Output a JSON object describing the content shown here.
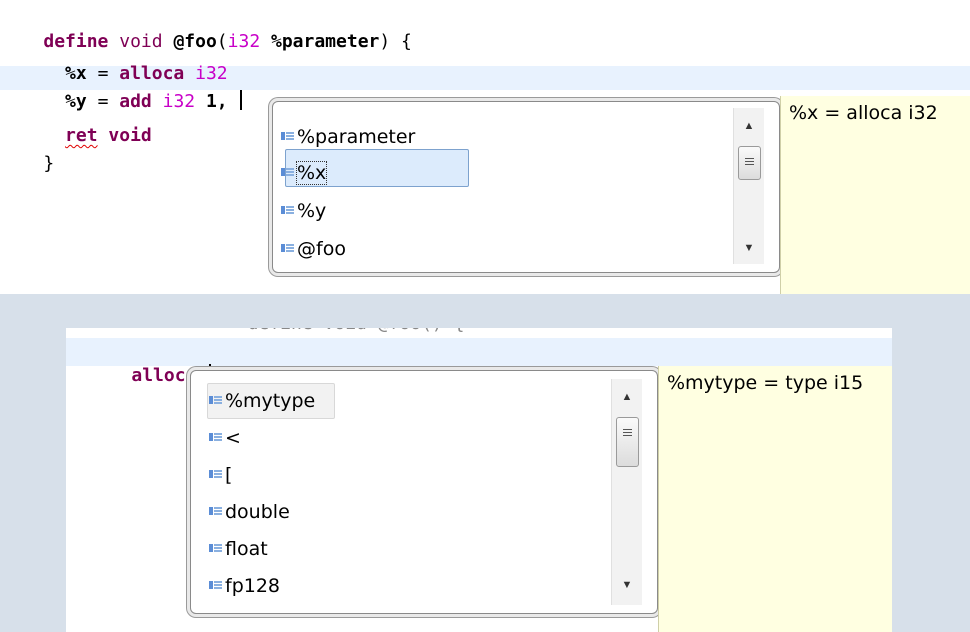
{
  "editor1": {
    "lines": [
      {
        "kw": "define",
        "sp1": " ",
        "kwv": "void",
        "sp2": " ",
        "name": "@foo",
        "lp": "(",
        "ty": "i32",
        "sp3": " ",
        "param": "%parameter",
        "rest": ") {"
      },
      {
        "indent": "  ",
        "var": "%x",
        "eq": " = ",
        "op": "alloca",
        "sp": " ",
        "ty": "i32"
      },
      {
        "indent": "  ",
        "var": "%y",
        "eq": " = ",
        "op": "add",
        "sp": " ",
        "ty": "i32",
        "tail": " 1, "
      },
      {
        "indent": "  ",
        "op": "ret",
        "sp": " ",
        "kwv": "void"
      },
      {
        "text": "}"
      }
    ]
  },
  "popup1": {
    "items": [
      "%parameter",
      "%x",
      "%y",
      "@foo"
    ],
    "selected": "%x",
    "doc": "%x = alloca i32"
  },
  "editor2": {
    "cut_line": "  define void @foo() {",
    "line": "alloca "
  },
  "popup2": {
    "items": [
      "%mytype",
      "<",
      "[",
      "double",
      "float",
      "fp128"
    ],
    "selected": "%mytype",
    "doc": "%mytype = type i15"
  },
  "colors": {
    "keyword": "#7f0055",
    "type": "#c800c8",
    "current_line": "#e8f2fe",
    "doc_background": "#ffffe1",
    "outer_background": "#d7e0ea"
  },
  "icons": {
    "scroll_up": "▲",
    "scroll_down": "▼",
    "item_icon": "field-icon"
  }
}
